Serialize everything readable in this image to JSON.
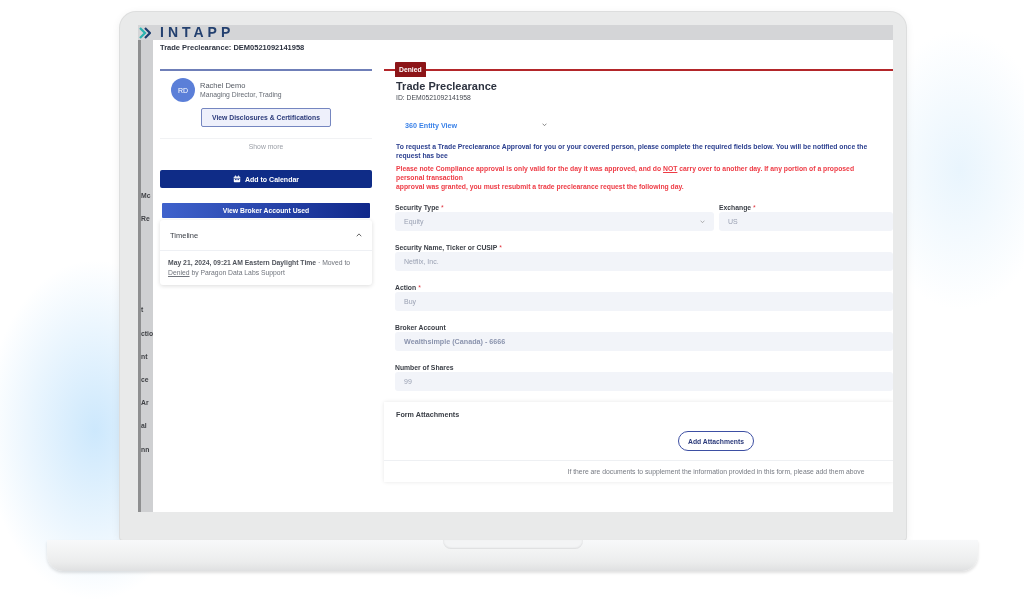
{
  "background_app": {
    "logo": "INTAPP",
    "sidebar_fragments": [
      "Mc",
      "Re",
      "t",
      "ctio",
      "nt",
      "ce",
      "Ar",
      "al",
      "nn"
    ]
  },
  "modal": {
    "title": "Trade Preclearance: DEM0521092141958"
  },
  "profile": {
    "initials": "RD",
    "name": "Rachel Demo",
    "role": "Managing Director, Trading",
    "disclosures_button": "View Disclosures & Certifications",
    "show_more": "Show more"
  },
  "actions": [
    {
      "label": "Add to Calendar",
      "kind": "primary"
    },
    {
      "label": "View Broker Account Used",
      "kind": "gradient"
    }
  ],
  "timeline": {
    "title": "Timeline",
    "expanded": true,
    "entries": [
      {
        "timestamp": "May 21, 2024, 09:21 AM Eastern Daylight Time",
        "action": "· Moved to",
        "status": "Denied",
        "actor": "by Paragon Data Labs Support"
      }
    ]
  },
  "request": {
    "status": "Denied",
    "title": "Trade Preclearance",
    "id": "ID: DEM0521092141958",
    "view_selector": "360 Entity View",
    "info": "To request a Trade Preclearance Approval for you or your covered person, please complete the required fields below. You will be notified once the request has bee",
    "warning_lines": [
      "Please note Compliance approval is only valid for the day it was approved, and do **NOT** carry over to another day. If any portion of a proposed personal transaction",
      "approval was granted, you must resubmit a trade preclearance request the following day."
    ],
    "field_rows": [
      [
        {
          "label": "Security Type",
          "required_mark": "*",
          "value": "Equity",
          "kind": "select"
        },
        {
          "label": "Exchange",
          "required_mark": "*",
          "value": "US",
          "kind": "text"
        }
      ],
      [
        {
          "label": "Security Name, Ticker or CUSIP",
          "required_mark": "*",
          "value": "Netflix, Inc.",
          "kind": "text"
        }
      ],
      [
        {
          "label": "Action",
          "required_mark": "*",
          "value": "Buy",
          "kind": "text"
        }
      ],
      [
        {
          "label": "Broker Account",
          "value": "Wealthsimple (Canada) - 6666",
          "kind": "account"
        }
      ],
      [
        {
          "label": "Number of Shares",
          "value": "99",
          "kind": "text"
        }
      ]
    ]
  },
  "attachments": {
    "title": "Form Attachments",
    "button": "Add Attachments",
    "hint": "If there are documents to supplement the information provided in this form, please add them above"
  }
}
